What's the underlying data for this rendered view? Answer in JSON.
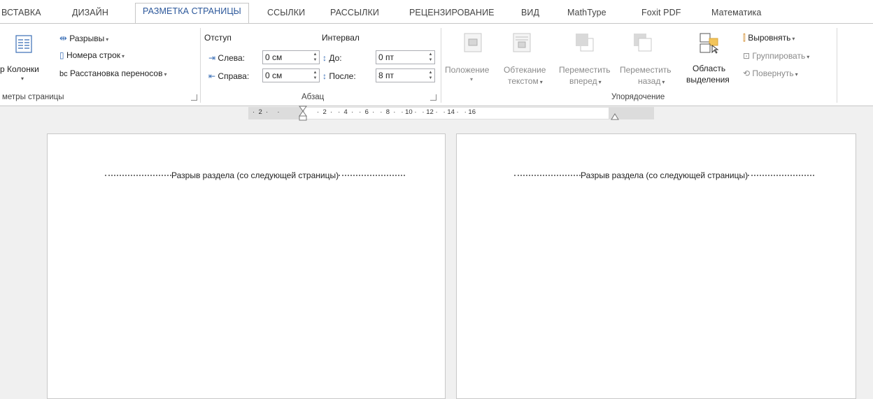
{
  "tabs": [
    "ВСТАВКА",
    "ДИЗАЙН",
    "РАЗМЕТКА СТРАНИЦЫ",
    "ССЫЛКИ",
    "РАССЫЛКИ",
    "РЕЦЕНЗИРОВАНИЕ",
    "ВИД",
    "MathType",
    "Foxit PDF",
    "Математика"
  ],
  "active_tab": "РАЗМЕТКА СТРАНИЦЫ",
  "page_setup": {
    "columns_label": "р Колонки",
    "breaks": "Разрывы",
    "line_numbers": "Номера строк",
    "hyphenation": "Расстановка переносов",
    "group_label": "метры страницы"
  },
  "paragraph": {
    "indent_header": "Отступ",
    "spacing_header": "Интервал",
    "left_label": "Слева:",
    "left_value": "0 см",
    "right_label": "Справа:",
    "right_value": "0 см",
    "before_label": "До:",
    "before_value": "0 пт",
    "after_label": "После:",
    "after_value": "8 пт",
    "group_label": "Абзац"
  },
  "arrange": {
    "position_line1": "Положение",
    "wrap_line1": "Обтекание",
    "wrap_line2": "текстом",
    "forward_line1": "Переместить",
    "forward_line2": "вперед",
    "backward_line1": "Переместить",
    "backward_line2": "назад",
    "selection_line1": "Область",
    "selection_line2": "выделения",
    "align": "Выровнять",
    "group": "Группировать",
    "rotate": "Повернуть",
    "group_label": "Упорядочение"
  },
  "ruler": {
    "left_text": "·  2  ·     ·",
    "right_text": "·  2  ·   ·  4  ·   ·  6  ·   ·  8  ·   · 10 ·   · 12 ·   · 14 ·   · 16"
  },
  "pages": [
    {
      "section_break": "Разрыв раздела (со следующей страницы)"
    },
    {
      "section_break": "Разрыв раздела (со следующей страницы)"
    }
  ]
}
